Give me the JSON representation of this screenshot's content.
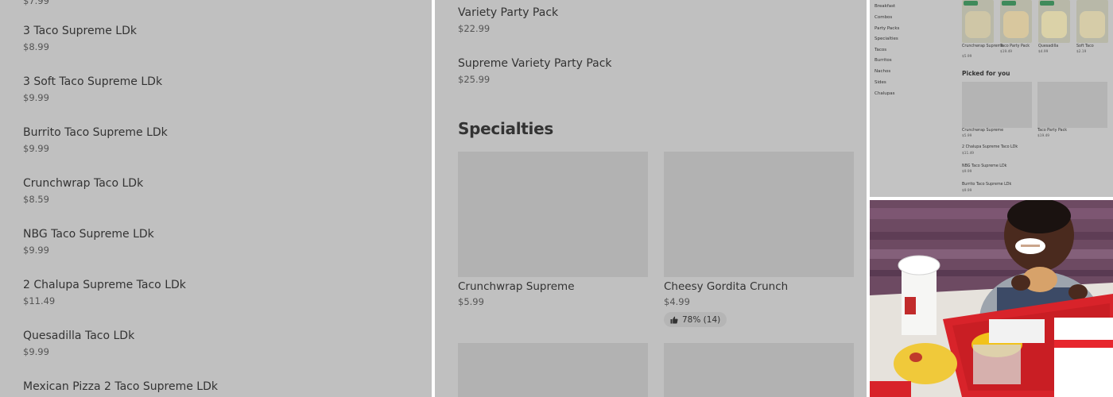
{
  "left_panel": {
    "partial_top_price": "$7.99",
    "items": [
      {
        "name": "3 Taco Supreme LDk",
        "price": "$8.99"
      },
      {
        "name": "3 Soft Taco Supreme LDk",
        "price": "$9.99"
      },
      {
        "name": "Burrito Taco Supreme LDk",
        "price": "$9.99"
      },
      {
        "name": "Crunchwrap Taco LDk",
        "price": "$8.59"
      },
      {
        "name": "NBG Taco Supreme LDk",
        "price": "$9.99"
      },
      {
        "name": "2 Chalupa Supreme Taco LDk",
        "price": "$11.49"
      },
      {
        "name": "Quesadilla Taco LDk",
        "price": "$9.99"
      },
      {
        "name": "Mexican Pizza 2 Taco Supreme LDk",
        "price": ""
      }
    ]
  },
  "middle_panel": {
    "items": [
      {
        "name": "Variety Party Pack",
        "price": "$22.99"
      },
      {
        "name": "Supreme Variety Party Pack",
        "price": "$25.99"
      }
    ],
    "section_title": "Specialties",
    "cards": [
      {
        "name": "Crunchwrap Supreme",
        "price": "$5.99"
      },
      {
        "name": "Cheesy Gordita Crunch",
        "price": "$4.99",
        "rating": "78% (14)"
      }
    ]
  },
  "mini_page": {
    "sidebar": [
      "Breakfast",
      "Combos",
      "Party Packs",
      "Specialties",
      "Tacos",
      "Burritos",
      "Nachos",
      "Sides",
      "Chalupas"
    ],
    "featured": [
      {
        "name": "Crunchwrap Supreme",
        "price": "$5.99"
      },
      {
        "name": "Taco Party Pack",
        "price": "$19.49"
      },
      {
        "name": "Quesadilla",
        "price": "$4.99"
      },
      {
        "name": "Soft Taco",
        "price": "$2.19"
      }
    ],
    "picked_heading": "Picked for you",
    "picked_cards": [
      {
        "name": "Crunchwrap Supreme",
        "price": "$5.99"
      },
      {
        "name": "Taco Party Pack",
        "price": "$19.49"
      }
    ],
    "picked_list": [
      {
        "name": "2 Chalupa Supreme Taco LDk",
        "price": "$11.49"
      },
      {
        "name": "NBG Taco Supreme LDk",
        "price": "$9.99"
      },
      {
        "name": "Burrito Taco Supreme LDk",
        "price": "$9.99"
      }
    ]
  },
  "colors": {
    "panel_bg": "#c0c0c0",
    "placeholder_bg": "#b2b2b2",
    "badge_green": "#3f8a5a",
    "tray_red": "#d8232a"
  },
  "icons": {
    "rating": "thumbs-up-icon"
  }
}
